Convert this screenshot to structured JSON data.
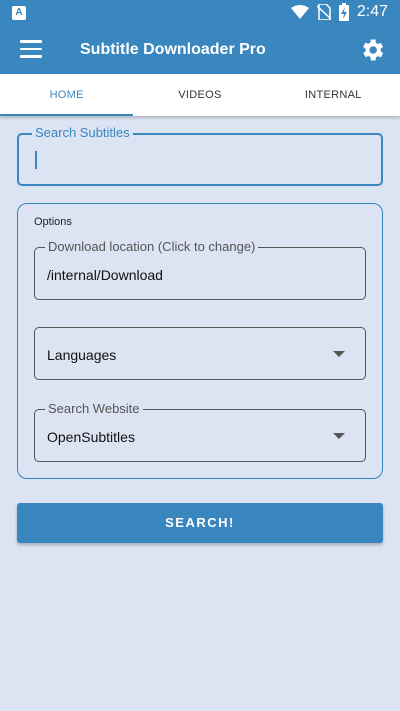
{
  "status_bar": {
    "left_icon": "A",
    "time": "2:47",
    "icons": [
      "wifi-icon",
      "no-sim-icon",
      "battery-charging-icon"
    ]
  },
  "app_bar": {
    "title": "Subtitle Downloader Pro",
    "menu_icon": "hamburger-menu-icon",
    "settings_icon": "gear-icon"
  },
  "tabs": [
    {
      "label": "HOME",
      "active": true
    },
    {
      "label": "VIDEOS",
      "active": false
    },
    {
      "label": "INTERNAL",
      "active": false
    }
  ],
  "search": {
    "label": "Search Subtitles",
    "value": ""
  },
  "options": {
    "title": "Options",
    "download_location": {
      "label": "Download location (Click to change)",
      "value": "/internal/Download"
    },
    "languages": {
      "value": "Languages"
    },
    "search_website": {
      "label": "Search Website",
      "value": "OpenSubtitles"
    }
  },
  "search_button": {
    "label": "SEARCH!"
  },
  "colors": {
    "primary": "#3a86bf",
    "background": "#dce3f2"
  }
}
